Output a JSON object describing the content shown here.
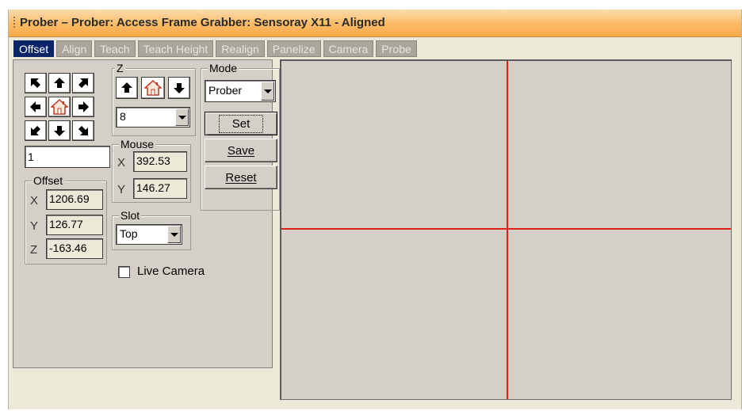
{
  "window": {
    "title": "Prober – Prober: Access Frame Grabber: Sensoray X11 - Aligned"
  },
  "tabs": [
    {
      "label": "Offset",
      "active": true
    },
    {
      "label": "Align"
    },
    {
      "label": "Teach"
    },
    {
      "label": "Teach Height"
    },
    {
      "label": "Realign"
    },
    {
      "label": "Panelize"
    },
    {
      "label": "Camera"
    },
    {
      "label": "Probe"
    }
  ],
  "jog": {
    "buttons": [
      "up-left",
      "up",
      "up-right",
      "left",
      "home",
      "right",
      "down-left",
      "down",
      "down-right"
    ],
    "step_value": "1"
  },
  "offset": {
    "label": "Offset",
    "x_label": "X",
    "x": "1206.69",
    "y_label": "Y",
    "y": "126.77",
    "z_label": "Z",
    "z": "-163.46"
  },
  "z_group": {
    "label": "Z",
    "step_select": "8"
  },
  "mouse": {
    "label": "Mouse",
    "x_label": "X",
    "x": "392.53",
    "y_label": "Y",
    "y": "146.27"
  },
  "slot": {
    "label": "Slot",
    "value": "Top"
  },
  "live_camera": {
    "label": "Live Camera",
    "checked": false
  },
  "mode": {
    "label": "Mode",
    "value": "Prober"
  },
  "buttons": {
    "set": "Set",
    "save": "Save",
    "reset": "Reset"
  },
  "colors": {
    "crosshair": "#e0201a",
    "active_tab": "#0a246a",
    "title_gradient_end": "#f9a94a"
  }
}
